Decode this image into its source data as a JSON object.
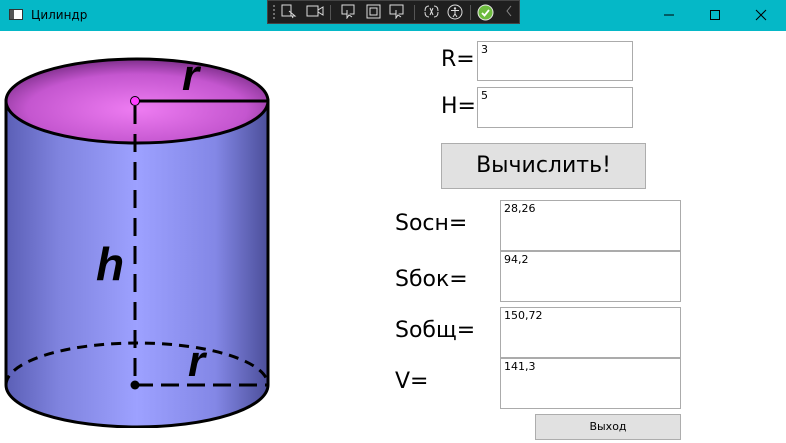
{
  "window": {
    "title": "Цилиндр"
  },
  "figure": {
    "label_r_top": "r",
    "label_h": "h",
    "label_r_bottom": "r",
    "colors": {
      "top": "#d86be0",
      "body": "#8a8ee6",
      "outline": "#000000"
    }
  },
  "inputs": {
    "r_label": "R=",
    "r_value": "3",
    "h_label": "H=",
    "h_value": "5"
  },
  "calculate_button": "Вычислить!",
  "results": {
    "s_base_label": "Sосн=",
    "s_base_value": "28,26",
    "s_side_label": "Sбок=",
    "s_side_value": "94,2",
    "s_total_label": "Sобщ=",
    "s_total_value": "150,72",
    "v_label": "V=",
    "v_value": "141,3"
  },
  "exit_button": "Выход",
  "toolbar_icons": [
    "grip-icon",
    "select-element-icon",
    "video-icon",
    "cursor-icon",
    "display-layout-icon",
    "track-focus-icon",
    "binding-failures-icon",
    "accessibility-icon",
    "check-icon",
    "collapse-icon"
  ],
  "titlebar_colors": {
    "background": "#05b8c7"
  }
}
